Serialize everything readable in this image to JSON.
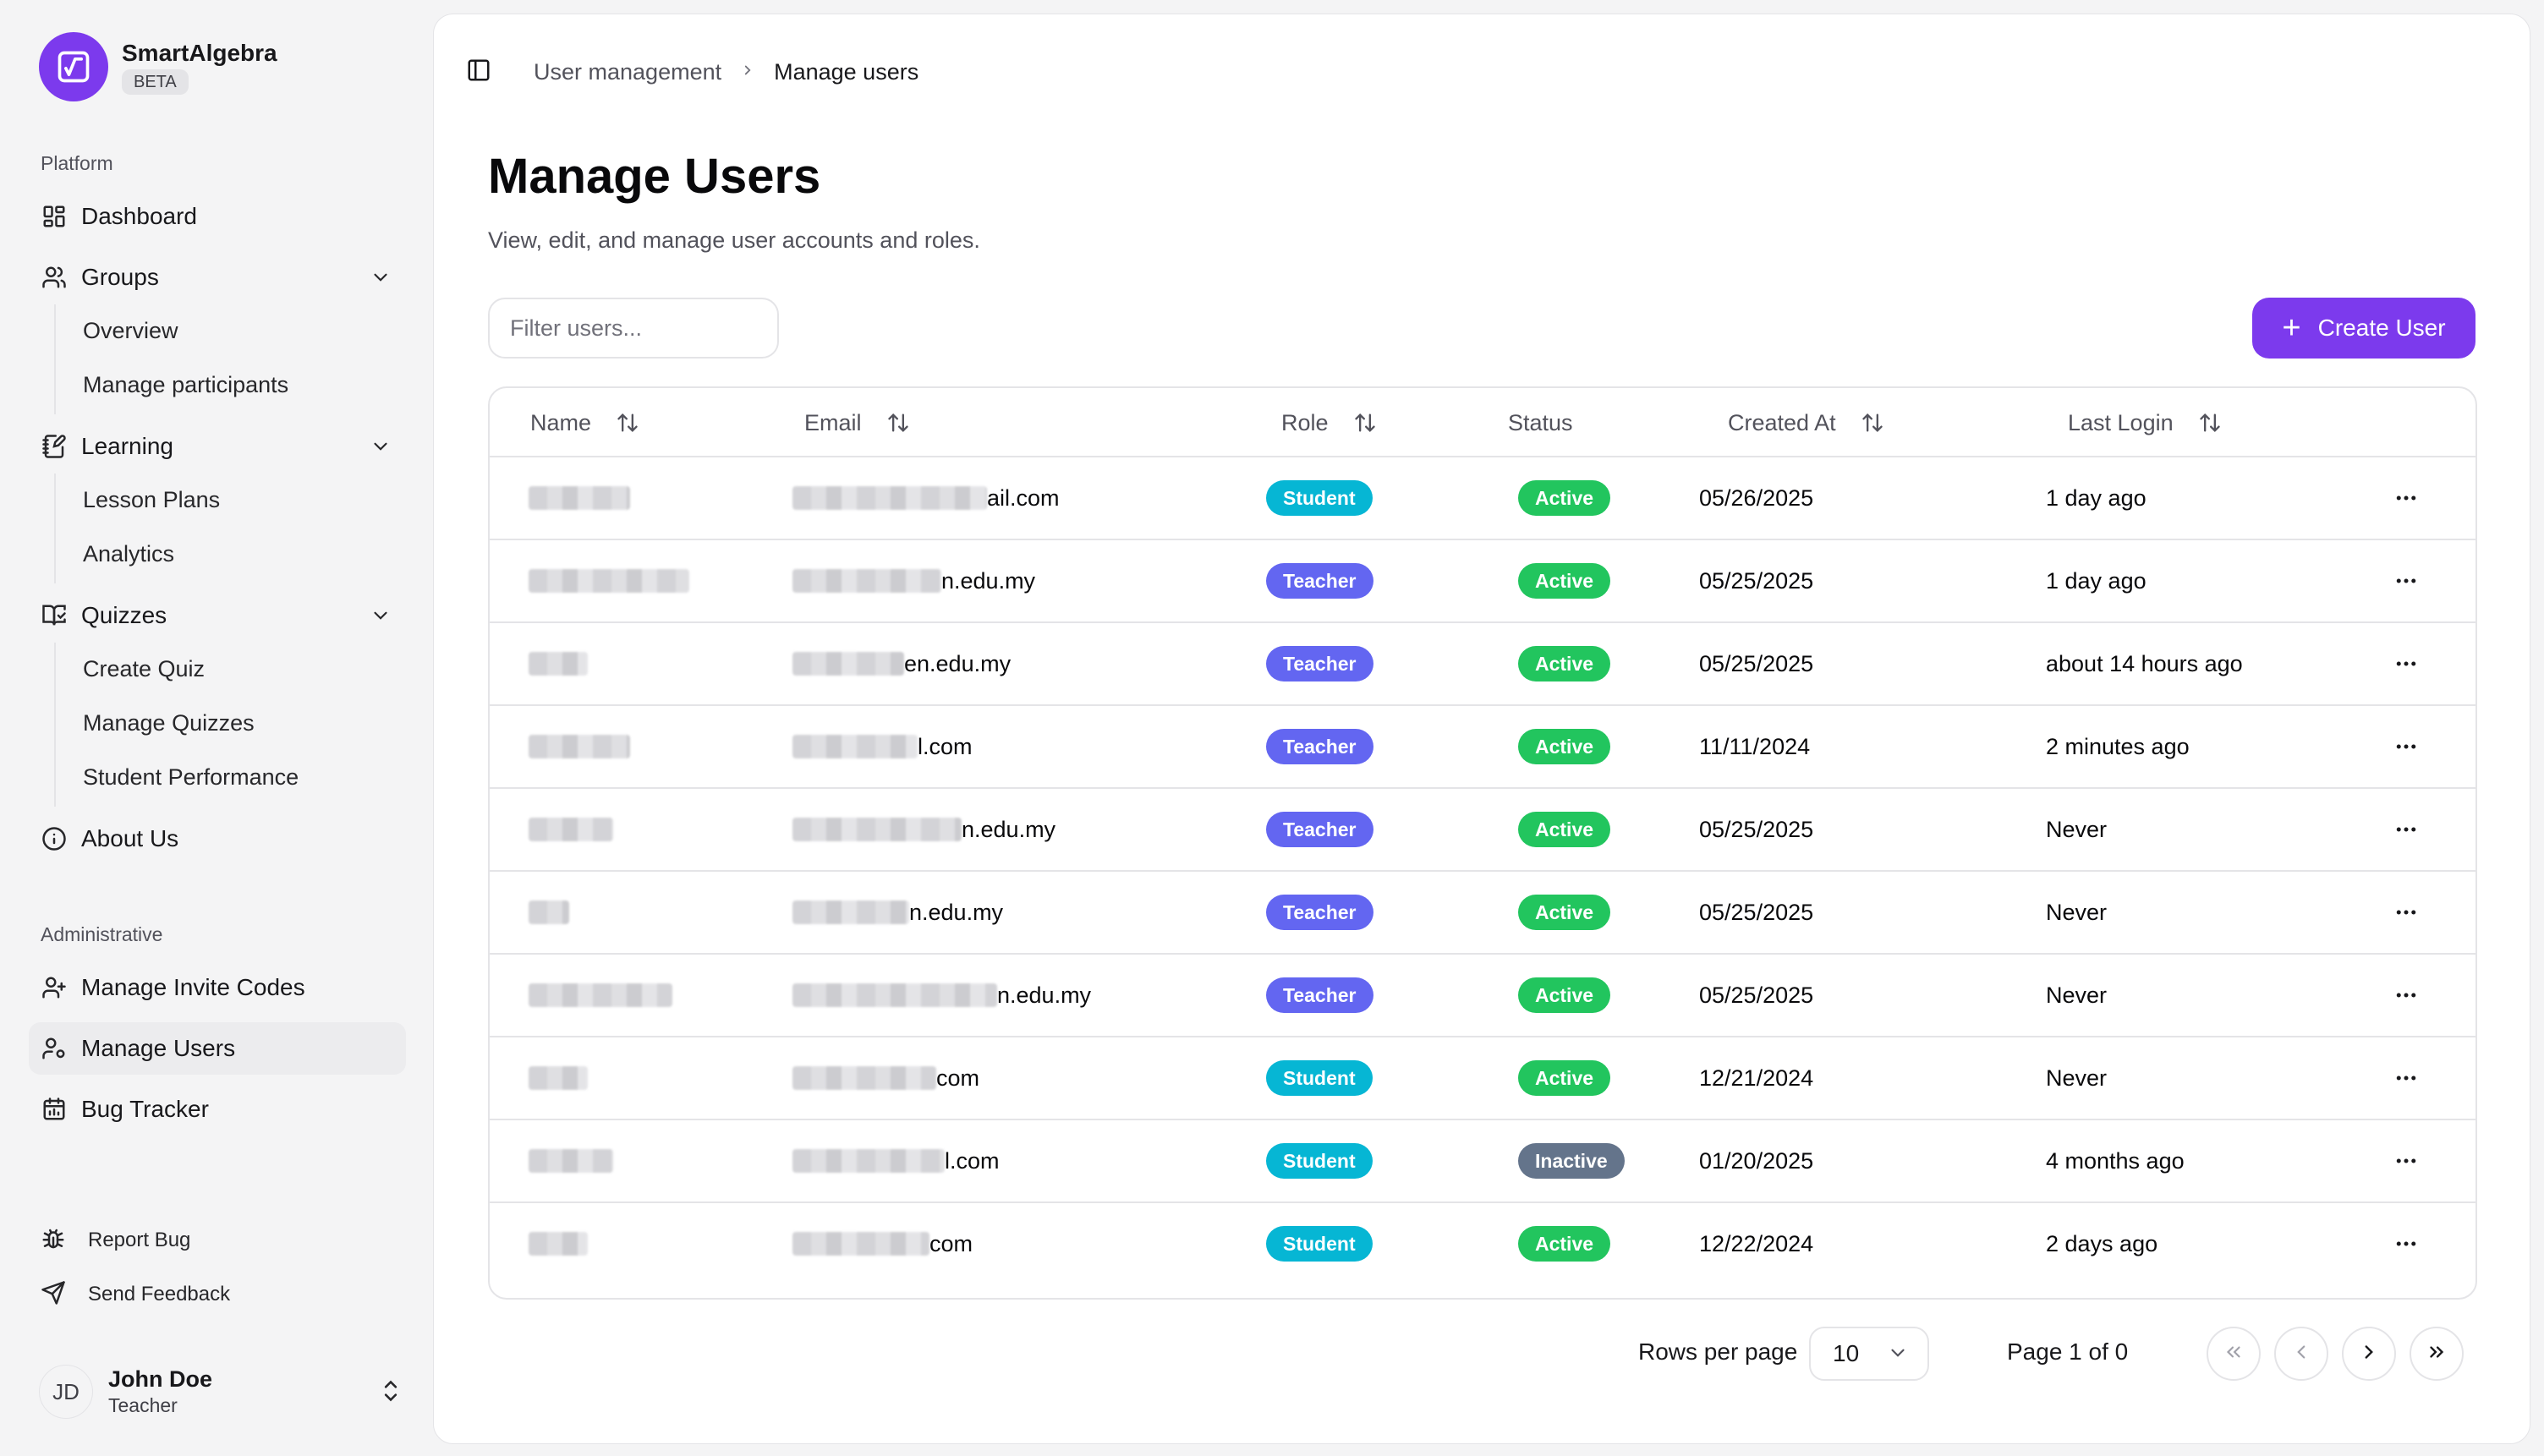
{
  "app": {
    "name": "SmartAlgebra",
    "badge": "BETA",
    "accent": "#7c3aed"
  },
  "sidebar": {
    "platform_label": "Platform",
    "admin_label": "Administrative",
    "items": {
      "dashboard": "Dashboard",
      "groups": "Groups",
      "groups_overview": "Overview",
      "groups_manage": "Manage participants",
      "learning": "Learning",
      "lesson_plans": "Lesson Plans",
      "analytics": "Analytics",
      "quizzes": "Quizzes",
      "create_quiz": "Create Quiz",
      "manage_quizzes": "Manage Quizzes",
      "student_performance": "Student Performance",
      "about": "About Us",
      "invite_codes": "Manage Invite Codes",
      "manage_users": "Manage Users",
      "bug_tracker": "Bug Tracker"
    },
    "footer": {
      "report_bug": "Report Bug",
      "send_feedback": "Send Feedback"
    },
    "user": {
      "initials": "JD",
      "name": "John Doe",
      "role": "Teacher"
    }
  },
  "breadcrumb": {
    "parent": "User management",
    "current": "Manage users"
  },
  "page": {
    "title": "Manage Users",
    "subtitle": "View, edit, and manage user accounts and roles.",
    "filter_placeholder": "Filter users...",
    "create_button": "Create User"
  },
  "table": {
    "columns": {
      "name": "Name",
      "email": "Email",
      "role": "Role",
      "status": "Status",
      "created": "Created At",
      "last_login": "Last Login"
    },
    "rows": [
      {
        "email_suffix": "ail.com",
        "role": "Student",
        "status": "Active",
        "created": "05/26/2025",
        "last_login": "1 day ago"
      },
      {
        "email_suffix": "n.edu.my",
        "role": "Teacher",
        "status": "Active",
        "created": "05/25/2025",
        "last_login": "1 day ago"
      },
      {
        "email_suffix": "en.edu.my",
        "role": "Teacher",
        "status": "Active",
        "created": "05/25/2025",
        "last_login": "about 14 hours ago"
      },
      {
        "email_suffix": "l.com",
        "role": "Teacher",
        "status": "Active",
        "created": "11/11/2024",
        "last_login": "2 minutes ago"
      },
      {
        "email_suffix": "n.edu.my",
        "role": "Teacher",
        "status": "Active",
        "created": "05/25/2025",
        "last_login": "Never"
      },
      {
        "email_suffix": "n.edu.my",
        "role": "Teacher",
        "status": "Active",
        "created": "05/25/2025",
        "last_login": "Never"
      },
      {
        "email_suffix": "n.edu.my",
        "role": "Teacher",
        "status": "Active",
        "created": "05/25/2025",
        "last_login": "Never"
      },
      {
        "email_suffix": "com",
        "role": "Student",
        "status": "Active",
        "created": "12/21/2024",
        "last_login": "Never"
      },
      {
        "email_suffix": "l.com",
        "role": "Student",
        "status": "Inactive",
        "created": "01/20/2025",
        "last_login": "4 months ago"
      },
      {
        "email_suffix": "com",
        "role": "Student",
        "status": "Active",
        "created": "12/22/2024",
        "last_login": "2 days ago"
      }
    ]
  },
  "colors": {
    "student": "#06b6d4",
    "teacher": "#6366f1",
    "active": "#22c55e",
    "inactive": "#64748b"
  },
  "pagination": {
    "rows_label": "Rows per page",
    "rows_value": "10",
    "page_label": "Page 1 of 0"
  }
}
